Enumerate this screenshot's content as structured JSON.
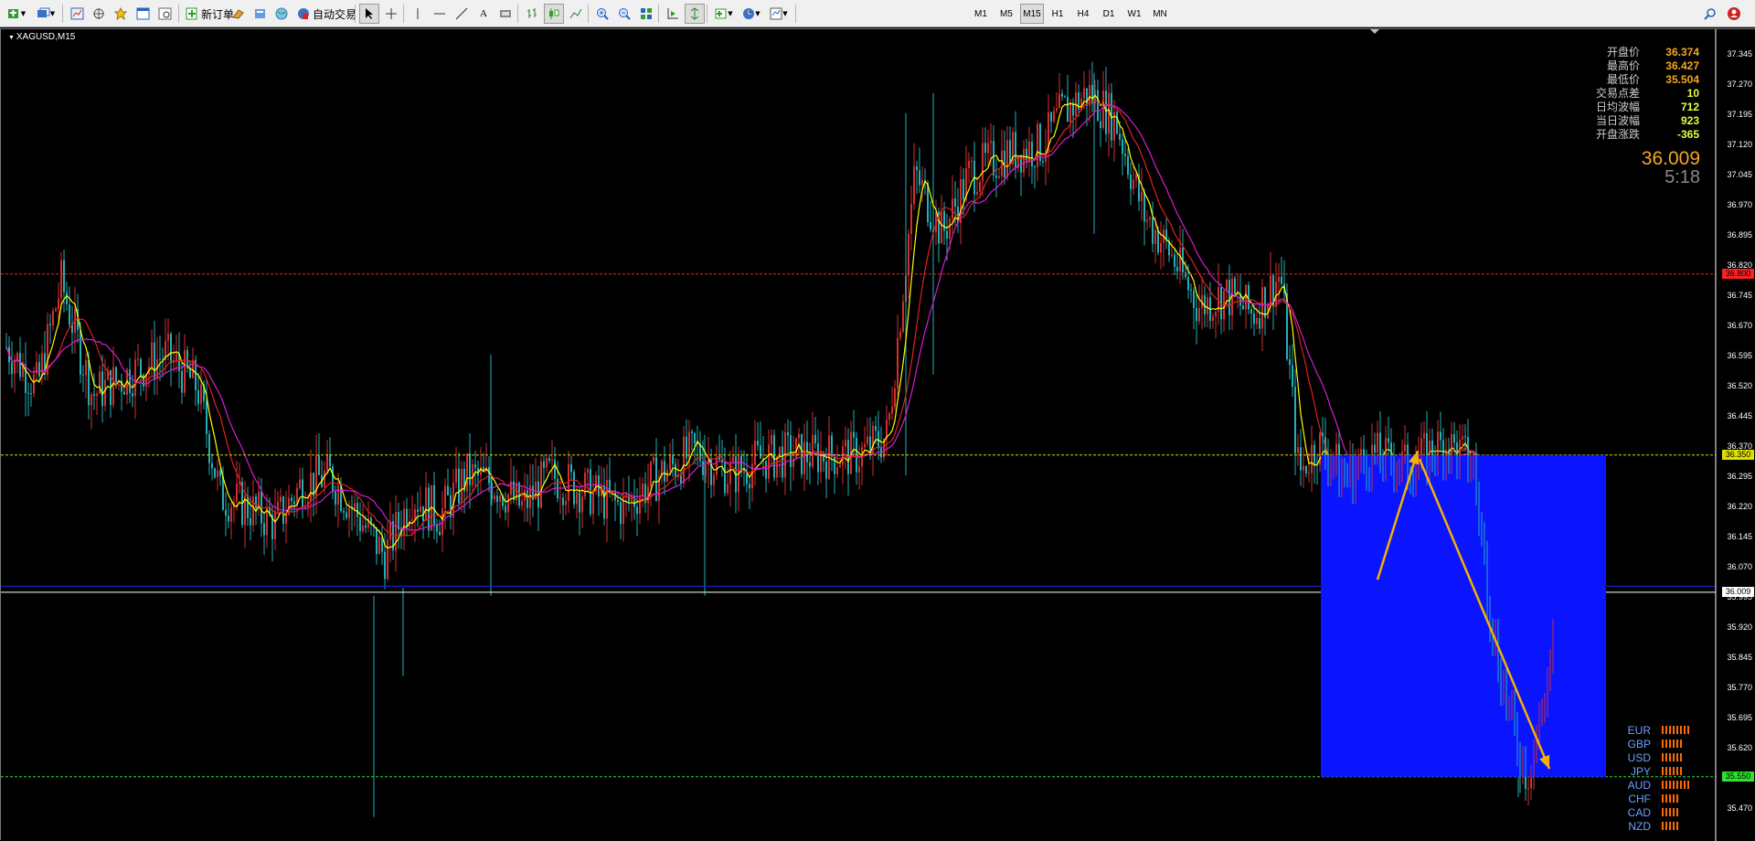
{
  "colors": {
    "bull": "#d03030",
    "bear": "#22b0b8",
    "ma_fast": "#ffff00",
    "ma_mid": "#e02020",
    "ma_slow": "#d020d0",
    "level_red": "#ff2020",
    "level_yellow": "#e0e000",
    "level_green": "#30e030",
    "level_blue": "#2020ff",
    "box": "#0a14ff",
    "arrow": "#f5b000",
    "value_orange": "#f5a623",
    "value_yellow": "#e6ff3c"
  },
  "toolbar": {
    "new_order_label": "新订单",
    "autotrade_label": "自动交易",
    "timeframes": [
      "M1",
      "M5",
      "M15",
      "H1",
      "H4",
      "D1",
      "W1",
      "MN"
    ],
    "active_timeframe": "M15",
    "icons": [
      "new-chart-icon",
      "profiles-icon",
      "market-watch-icon",
      "navigator-icon",
      "favorites-icon",
      "terminal-icon",
      "strategy-tester-icon",
      "metaeditor-icon",
      "signals-icon",
      "cursor-icon",
      "crosshair-icon",
      "vertical-line-icon",
      "horizontal-line-icon",
      "trendline-icon",
      "text-icon",
      "label-icon",
      "bar-chart-icon",
      "candlestick-icon",
      "line-chart-icon",
      "zoom-in-icon",
      "zoom-out-icon",
      "tile-windows-icon",
      "chart-shift-icon",
      "autoscroll-icon",
      "indicators-icon",
      "periods-icon",
      "templates-icon",
      "search-icon"
    ]
  },
  "chart": {
    "symbol_label": "XAGUSD,M15",
    "price_ticks": [
      "37.345",
      "37.270",
      "37.195",
      "37.120",
      "37.045",
      "36.970",
      "36.895",
      "36.820",
      "36.745",
      "36.670",
      "36.595",
      "36.520",
      "36.445",
      "36.370",
      "36.295",
      "36.220",
      "36.145",
      "36.070",
      "35.995",
      "35.920",
      "35.845",
      "35.770",
      "35.695",
      "35.620",
      "35.545",
      "35.470"
    ],
    "levels": [
      {
        "price": 36.8,
        "color": "level_red",
        "style": "dash",
        "tag": "36.800"
      },
      {
        "price": 36.35,
        "color": "level_yellow",
        "style": "dash",
        "tag": "36.350"
      },
      {
        "price": 36.024,
        "color": "level_blue",
        "style": "solid"
      },
      {
        "price": 36.009,
        "color": "level_white",
        "style": "solid",
        "tag": "36.009"
      },
      {
        "price": 35.55,
        "color": "level_green",
        "style": "dash",
        "tag": "35.550"
      }
    ]
  },
  "info_panel": [
    {
      "label": "开盘价",
      "value": "36.374",
      "color": "orange"
    },
    {
      "label": "最高价",
      "value": "36.427",
      "color": "orange"
    },
    {
      "label": "最低价",
      "value": "35.504",
      "color": "orange"
    },
    {
      "label": "交易点差",
      "value": "10",
      "color": "yellow"
    },
    {
      "label": "日均波幅",
      "value": "712",
      "color": "yellow"
    },
    {
      "label": "当日波幅",
      "value": "923",
      "color": "yellow"
    },
    {
      "label": "开盘涨跌",
      "value": "-365",
      "color": "yellow"
    }
  ],
  "big_price": "36.009",
  "timer": "5:18",
  "currency_strength": [
    {
      "name": "EUR",
      "bars": 8
    },
    {
      "name": "GBP",
      "bars": 6
    },
    {
      "name": "USD",
      "bars": 6
    },
    {
      "name": "JPY",
      "bars": 6
    },
    {
      "name": "AUD",
      "bars": 8
    },
    {
      "name": "CHF",
      "bars": 5
    },
    {
      "name": "CAD",
      "bars": 5
    },
    {
      "name": "NZD",
      "bars": 5
    }
  ]
}
